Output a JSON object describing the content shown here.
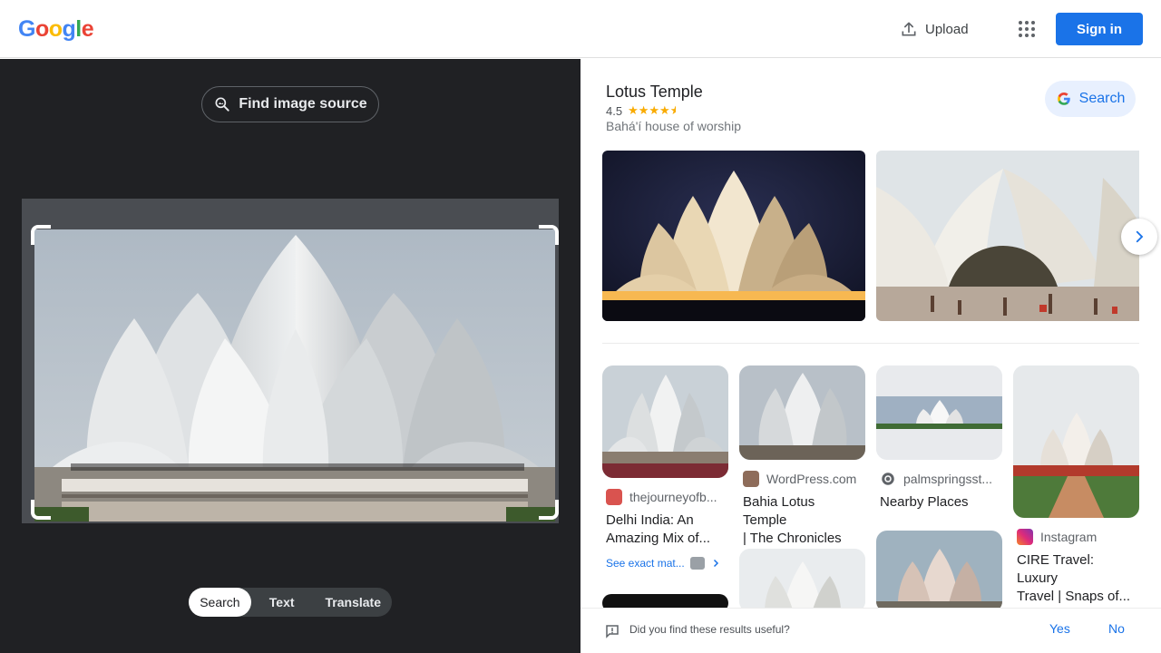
{
  "header": {
    "logo_letters": [
      {
        "ch": "G",
        "color": "#4285F4"
      },
      {
        "ch": "o",
        "color": "#EA4335"
      },
      {
        "ch": "o",
        "color": "#FBBC05"
      },
      {
        "ch": "g",
        "color": "#4285F4"
      },
      {
        "ch": "l",
        "color": "#34A853"
      },
      {
        "ch": "e",
        "color": "#EA4335"
      }
    ],
    "upload_label": "Upload",
    "sign_in_label": "Sign in",
    "accent": "#1a73e8"
  },
  "left": {
    "find_source_label": "Find image source",
    "modes": [
      "Search",
      "Text",
      "Translate"
    ],
    "active_mode": "Search"
  },
  "knowledge": {
    "title": "Lotus Temple",
    "rating": "4.5",
    "stars": "★★★★",
    "half_star": "★",
    "subtitle": "Bahá'í house of worship",
    "search_label": "Search"
  },
  "results": [
    {
      "source": "thejourneyofb...",
      "caption_line1": "Delhi India: An",
      "caption_line2": "Amazing Mix of..."
    },
    {
      "source": "WordPress.com",
      "caption_line1": "Bahia Lotus Temple",
      "caption_line2": "| The Chronicles o..."
    },
    {
      "source": "palmspringsst...",
      "caption_line1": "Nearby Places",
      "caption_line2": ""
    },
    {
      "source": "Instagram",
      "caption_line1": "CIRE Travel: Luxury",
      "caption_line2": "Travel | Snaps of..."
    }
  ],
  "exact_matches_label": "See exact mat...",
  "feedback": {
    "question": "Did you find these results useful?",
    "yes": "Yes",
    "no": "No"
  }
}
